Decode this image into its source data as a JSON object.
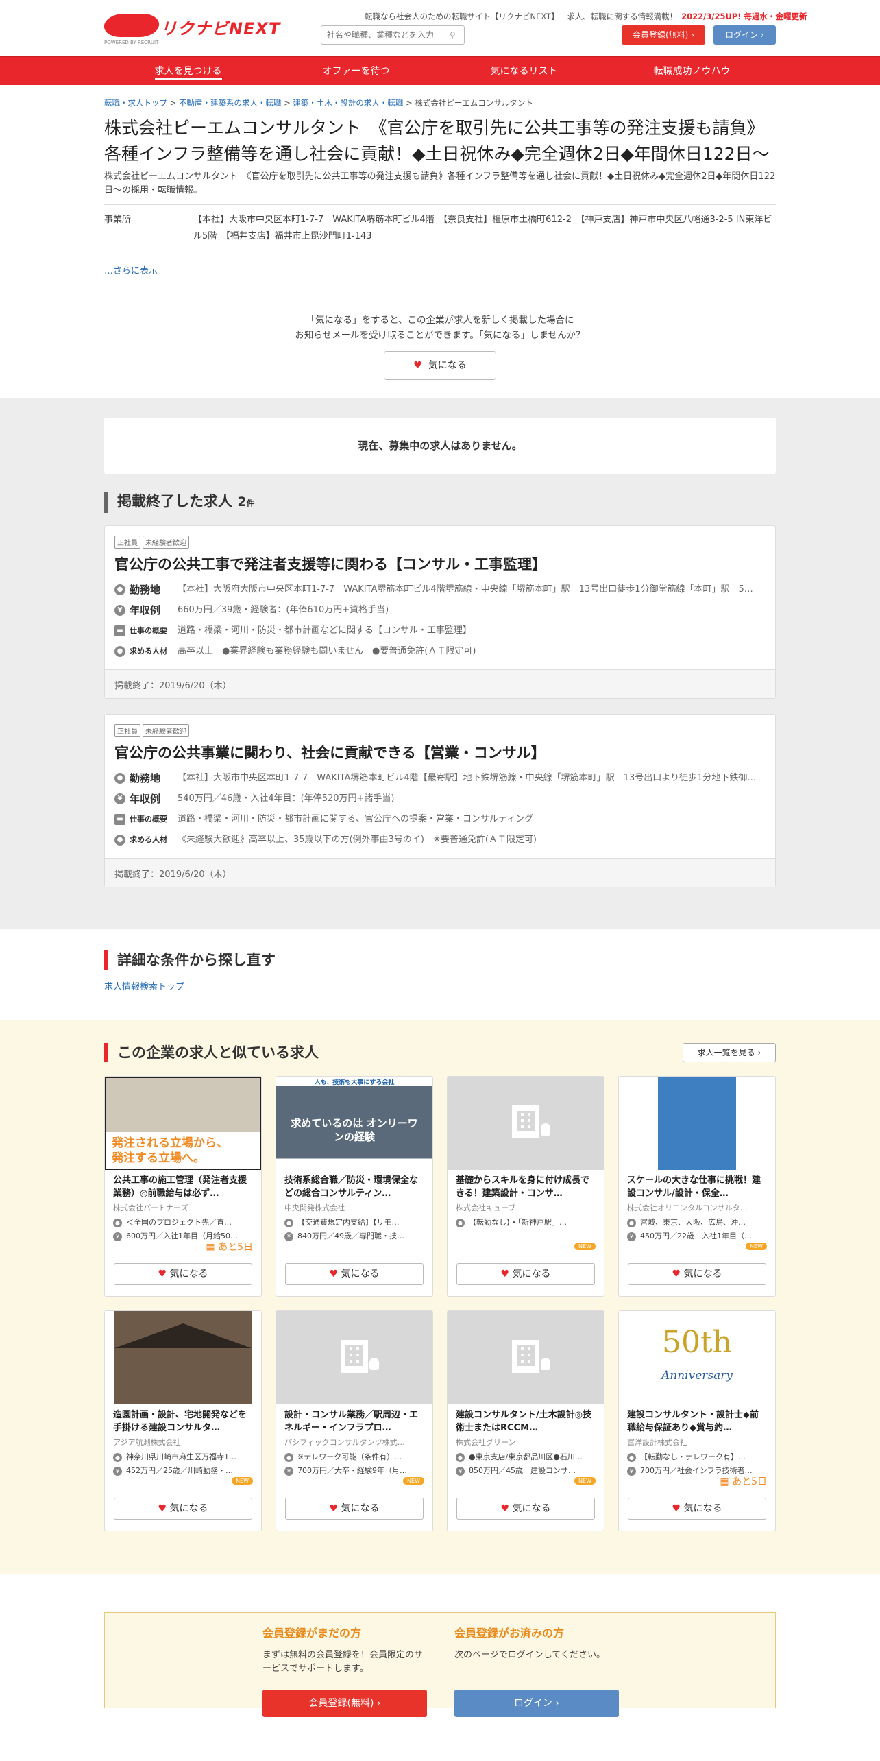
{
  "header": {
    "logo_text": "リクナビNEXT",
    "logo_sub": "POWERED BY RECRUIT",
    "tagline": "転職なら社会人のための転職サイト【リクナビNEXT】｜求人、転職に関する情報満載！",
    "update": "2022/3/25UP! 毎週水・金曜更新",
    "search_placeholder": "社名や職種、業種などを入力",
    "register_label": "会員登録(無料)",
    "login_label": "ログイン"
  },
  "nav": [
    "求人を見つける",
    "オファーを待つ",
    "気になるリスト",
    "転職成功ノウハウ"
  ],
  "breadcrumb": [
    "転職・求人トップ",
    "不動産・建築系の求人・転職",
    "建築・土木・設計の求人・転職",
    "株式会社ピーエムコンサルタント"
  ],
  "company": {
    "title": "株式会社ピーエムコンサルタント　《官公庁を取引先に公共工事等の発注支援も請負》各種インフラ整備等を通し社会に貢献！◆土日祝休み◆完全週休2日◆年間休日122日～",
    "subtitle": "株式会社ピーエムコンサルタント　《官公庁を取引先に公共工事等の発注支援も請負》各種インフラ整備等を通し社会に貢献！◆土日祝休み◆完全週休2日◆年間休日122日～の採用・転職情報。",
    "office_label": "事業所",
    "office_value": "【本社】大阪市中央区本町1-7-7　WAKITA堺筋本町ビル4階　【奈良支社】橿原市土橋町612-2　【神戸支店】神戸市中央区八幡通3-2-5 IN東洋ビル5階　【福井支店】福井市上毘沙門町1-143",
    "more": "…さらに表示",
    "fav_note_1": "「気になる」をすると、この企業が求人を新しく掲載した場合に",
    "fav_note_2": "お知らせメールを受け取ることができます。「気になる」しませんか？",
    "fav_label": "気になる"
  },
  "jobs_section": {
    "no_open": "現在、募集中の求人はありません。",
    "closed_title": "掲載終了した求人",
    "closed_count": "2",
    "closed_unit": "件"
  },
  "jobs": [
    {
      "tags": [
        "正社員",
        "未経験者歓迎"
      ],
      "title": "官公庁の公共工事で発注者支援等に関わる【コンサル・工事監理】",
      "location_label": "勤務地",
      "location": "【本社】大阪府大阪市中央区本町1-7-7　WAKITA堺筋本町ビル4階堺筋線・中央線「堺筋本町」駅　13号出口徒歩1分御堂筋線「本町」駅　5…",
      "salary_label": "年収例",
      "salary": "660万円／39歳・経験者：(年俸610万円+資格手当)",
      "summary_label": "仕事の概要",
      "summary": "道路・橋梁・河川・防災・都市計画などに関する【コンサル・工事監理】",
      "req_label": "求める人材",
      "req": "高卒以上　●業界経験も業務経験も問いません　●要普通免許(ＡＴ限定可)",
      "end": "掲載終了：2019/6/20（木）"
    },
    {
      "tags": [
        "正社員",
        "未経験者歓迎"
      ],
      "title": "官公庁の公共事業に関わり、社会に貢献できる【営業・コンサル】",
      "location_label": "勤務地",
      "location": "【本社】大阪市中央区本町1-7-7　WAKITA堺筋本町ビル4階【最寄駅】地下鉄堺筋線・中央線「堺筋本町」駅　13号出口より徒歩1分地下鉄御…",
      "salary_label": "年収例",
      "salary": "540万円／46歳・入社4年目：(年俸520万円+諸手当)",
      "summary_label": "仕事の概要",
      "summary": "道路・橋梁・河川・防災・都市計画に関する、官公庁への提案・営業・コンサルティング",
      "req_label": "求める人材",
      "req": "《未経験大歓迎》高卒以上、35歳以下の方(例外事由3号のイ)　※要普通免許(ＡＴ限定可)",
      "end": "掲載終了：2019/6/20（木）"
    }
  ],
  "detail": {
    "title": "詳細な条件から探し直す",
    "link": "求人情報検索トップ"
  },
  "similar": {
    "title": "この企業の求人と似ている求人",
    "list_btn": "求人一覧を見る",
    "fav_label": "気になる",
    "cards": [
      {
        "title": "公共工事の施工管理（発注者支援業務）◎前職給与は必ず…",
        "company": "株式会社パートナーズ",
        "loc": "＜全国のプロジェクト先／直…",
        "pay": "600万円／入社1年目（月給50…",
        "badge": "",
        "deadline": "あと5日",
        "img": "photo1",
        "img_text_1": "発注される立場から、",
        "img_text_2": "発注する立場へ。"
      },
      {
        "title": "技術系総合職／防災・環境保全などの総合コンサルティン…",
        "company": "中央開発株式会社",
        "loc": "【交通費規定内支給】【リモ…",
        "pay": "840万円／49歳／専門職・技…",
        "badge": "",
        "deadline": "",
        "img": "photo2",
        "img_text_1": "人も、技術も大事にする会社",
        "img_text_2": "求めているのは オンリーワンの経験"
      },
      {
        "title": "基礎からスキルを身に付け成長できる！建築設計・コンサ…",
        "company": "株式会社キューブ",
        "loc": "【転勤なし】・「新神戸駅」…",
        "pay": "",
        "badge": "NEW",
        "deadline": "",
        "img": "placeholder"
      },
      {
        "title": "スケールの大きな仕事に挑戦！建設コンサル/設計・保全…",
        "company": "株式会社オリエンタルコンサルタ…",
        "loc": "宮城、東京、大阪、広島、沖…",
        "pay": "450万円／22歳　入社1年目（…",
        "badge": "NEW",
        "deadline": "",
        "img": "photo3"
      },
      {
        "title": "造園計画・設計、宅地開発などを手掛ける建設コンサルタ…",
        "company": "アジア航測株式会社",
        "loc": "神奈川県川崎市麻生区万福寺1…",
        "pay": "452万円／25歳／川崎勤務・…",
        "badge": "NEW",
        "deadline": "",
        "img": "photo4"
      },
      {
        "title": "設計・コンサル業務／駅周辺・エネルギー・インフラプロ…",
        "company": "パシフィックコンサルタンツ株式…",
        "loc": "※テレワーク可能（条件有）…",
        "pay": "700万円／大卒・経験9年（月…",
        "badge": "NEW",
        "deadline": "",
        "img": "placeholder"
      },
      {
        "title": "建設コンサルタント/土木設計◎技術士またはRCCM…",
        "company": "株式会社グリーン",
        "loc": "●東京支店/東京都品川区●石川…",
        "pay": "850万円／45歳　建設コンサ…",
        "badge": "NEW",
        "deadline": "",
        "img": "placeholder"
      },
      {
        "title": "建設コンサルタント・設計士◆前職給与保証あり◆賞与約…",
        "company": "富洋設計株式会社",
        "loc": "【転勤なし・テレワーク有】…",
        "pay": "700万円／社会インフラ技術者…",
        "badge": "",
        "deadline": "あと5日",
        "img": "photo5",
        "img_text_1": "50th",
        "img_text_2": "Anniversary"
      }
    ]
  },
  "bottom": {
    "left_title": "会員登録がまだの方",
    "left_text": "まずは無料の会員登録を！会員限定のサービスでサポートします。",
    "left_btn": "会員登録(無料)",
    "right_title": "会員登録がお済みの方",
    "right_text": "次のページでログインしてください。",
    "right_btn": "ログイン"
  },
  "colors": {
    "brand": "#e8262b",
    "link": "#2a6fb8",
    "login": "#5b8bc4",
    "accent": "#f08a23"
  }
}
